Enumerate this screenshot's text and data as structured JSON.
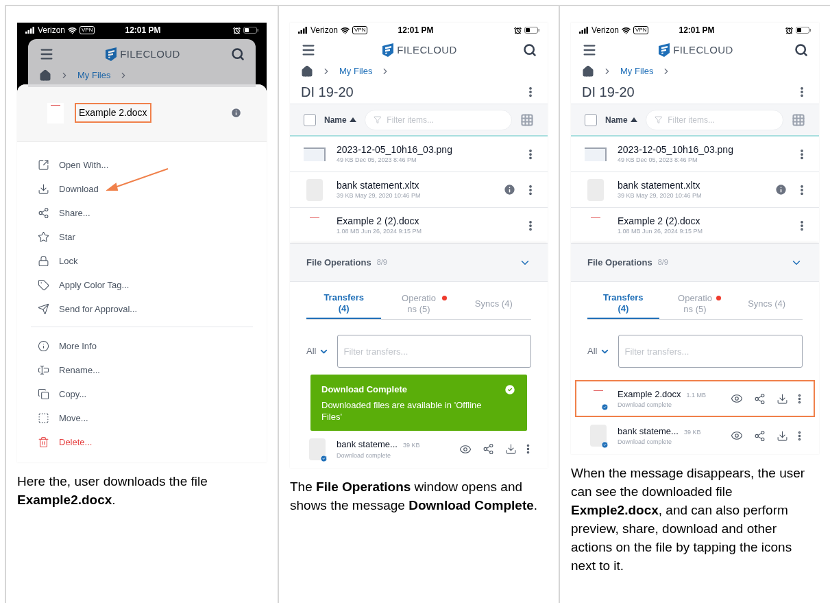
{
  "steps": [
    {
      "kind": "actions",
      "status_bar": {
        "dark": true,
        "carrier": "Verizon",
        "vpn": "VPN",
        "time": "12:01 PM"
      },
      "app_header": {
        "brand": "FILECLOUD"
      },
      "breadcrumb": [
        "My Files"
      ],
      "file": {
        "name": "Example 2.docx",
        "highlighted": true
      },
      "menu_groups": [
        [
          {
            "label": "Open With...",
            "danger": false
          },
          {
            "label": "Download",
            "danger": false
          },
          {
            "label": "Share...",
            "danger": false
          },
          {
            "label": "Star",
            "danger": false
          },
          {
            "label": "Lock",
            "danger": false
          },
          {
            "label": "Apply Color Tag...",
            "danger": false
          },
          {
            "label": "Send for Approval...",
            "danger": false
          }
        ],
        [
          {
            "label": "More Info",
            "danger": false
          },
          {
            "label": "Rename...",
            "danger": false
          },
          {
            "label": "Copy...",
            "danger": false
          },
          {
            "label": "Move...",
            "danger": false
          },
          {
            "label": "Delete...",
            "danger": true
          }
        ]
      ],
      "caption": "Here the, user downloads the file **Example2.docx**."
    },
    {
      "kind": "browser",
      "status_bar": {
        "dark": false,
        "carrier": "Verizon",
        "vpn": "VPN",
        "time": "12:01 PM"
      },
      "app_header": {
        "brand": "FILECLOUD"
      },
      "breadcrumb": [
        "My Files"
      ],
      "folder_title": "DI 19-20",
      "list_header": {
        "checked": false,
        "sort_label": "Name",
        "filter_placeholder": "Filter items..."
      },
      "files": [
        {
          "kind": "image",
          "name": "2023-12-05_10h16_03.png",
          "meta": "49 KB Dec 05, 2023 8:46 PM",
          "info": false
        },
        {
          "kind": "blank",
          "name": "bank statement.xltx",
          "meta": "39 KB May 29, 2020 10:46 PM",
          "info": true
        },
        {
          "kind": "doc",
          "name": "Example 2 (2).docx",
          "meta": "1.08 MB Jun 26, 2024 9:15 PM",
          "info": false
        }
      ],
      "file_operations": {
        "title": "File Operations",
        "count": "8/9",
        "tabs": [
          {
            "label": "Transfers\n(4)",
            "selected": true,
            "alert": false
          },
          {
            "label": "Operatio\nns (5)",
            "selected": false,
            "alert": true
          },
          {
            "label": "Syncs (4)",
            "selected": false,
            "alert": false
          }
        ],
        "scope": "All",
        "filter_placeholder": "Filter transfers...",
        "toast": {
          "title": "Download Complete",
          "message": "Downloaded files are available in 'Offline Files'"
        },
        "transfers": [
          {
            "kind": "blank",
            "name": "bank stateme...",
            "size": "39 KB",
            "status": "Download complete",
            "highlighted": false
          }
        ]
      },
      "caption": "The **File Operations** window opens and shows the message **Download Complete**."
    },
    {
      "kind": "browser",
      "status_bar": {
        "dark": false,
        "carrier": "Verizon",
        "vpn": "VPN",
        "time": "12:01 PM"
      },
      "app_header": {
        "brand": "FILECLOUD"
      },
      "breadcrumb": [
        "My Files"
      ],
      "folder_title": "DI 19-20",
      "list_header": {
        "checked": false,
        "sort_label": "Name",
        "filter_placeholder": "Filter items..."
      },
      "files": [
        {
          "kind": "image",
          "name": "2023-12-05_10h16_03.png",
          "meta": "49 KB Dec 05, 2023 8:46 PM",
          "info": false
        },
        {
          "kind": "blank",
          "name": "bank statement.xltx",
          "meta": "39 KB May 29, 2020 10:46 PM",
          "info": true
        },
        {
          "kind": "doc",
          "name": "Example 2 (2).docx",
          "meta": "1.08 MB Jun 26, 2024 9:15 PM",
          "info": false
        }
      ],
      "file_operations": {
        "title": "File Operations",
        "count": "8/9",
        "tabs": [
          {
            "label": "Transfers\n(4)",
            "selected": true,
            "alert": false
          },
          {
            "label": "Operatio\nns (5)",
            "selected": false,
            "alert": true
          },
          {
            "label": "Syncs (4)",
            "selected": false,
            "alert": false
          }
        ],
        "scope": "All",
        "filter_placeholder": "Filter transfers...",
        "transfers": [
          {
            "kind": "doc",
            "name": "Example 2.docx",
            "size": "1.1 MB",
            "status": "Download complete",
            "highlighted": true
          },
          {
            "kind": "blank",
            "name": "bank stateme...",
            "size": "39 KB",
            "status": "Download complete",
            "highlighted": false
          }
        ]
      },
      "caption": "When the message disappears, the user can see the downloaded file **Exmple2.docx**, and can also perform preview, share, download and other actions on the file by tapping the icons next to it."
    }
  ]
}
